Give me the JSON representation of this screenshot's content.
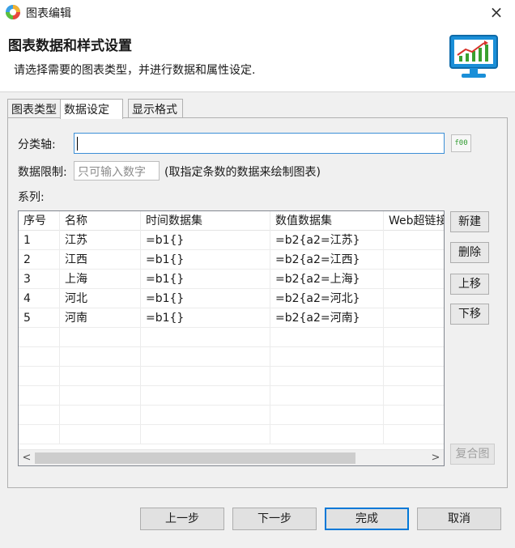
{
  "window": {
    "title": "图表编辑",
    "close_glyph": "×",
    "icon": "app-logo-icon"
  },
  "header": {
    "title": "图表数据和样式设置",
    "subtitle": "请选择需要的图表类型，并进行数据和属性设定.",
    "image": "chart-monitor-icon"
  },
  "tabs": [
    {
      "label": "图表类型",
      "active": false
    },
    {
      "label": "数据设定",
      "active": true
    },
    {
      "label": "显示格式",
      "active": false
    }
  ],
  "form": {
    "axis_label": "分类轴:",
    "axis_value": "",
    "fx_label": "f00",
    "limit_label": "数据限制:",
    "limit_placeholder": "只可输入数字",
    "limit_hint": "(取指定条数的数据来绘制图表)",
    "series_label": "系列:"
  },
  "table": {
    "columns": [
      "序号",
      "名称",
      "时间数据集",
      "数值数据集",
      "Web超链接"
    ],
    "rows": [
      [
        "1",
        "江苏",
        "=b1{}",
        "=b2{a2=江苏}",
        ""
      ],
      [
        "2",
        "江西",
        "=b1{}",
        "=b2{a2=江西}",
        ""
      ],
      [
        "3",
        "上海",
        "=b1{}",
        "=b2{a2=上海}",
        ""
      ],
      [
        "4",
        "河北",
        "=b1{}",
        "=b2{a2=河北}",
        ""
      ],
      [
        "5",
        "河南",
        "=b1{}",
        "=b2{a2=河南}",
        ""
      ]
    ],
    "empty_rows": 6,
    "scroll_left": "<",
    "scroll_right": ">"
  },
  "side_buttons": {
    "new": "新建",
    "delete": "删除",
    "up": "上移",
    "down": "下移",
    "combo": "复合图"
  },
  "footer": {
    "prev": "上一步",
    "next": "下一步",
    "finish": "完成",
    "cancel": "取消"
  },
  "colors": {
    "accent": "#0078d7",
    "input_focus": "#3c8fd6",
    "fx_green": "#2e9a2e"
  }
}
